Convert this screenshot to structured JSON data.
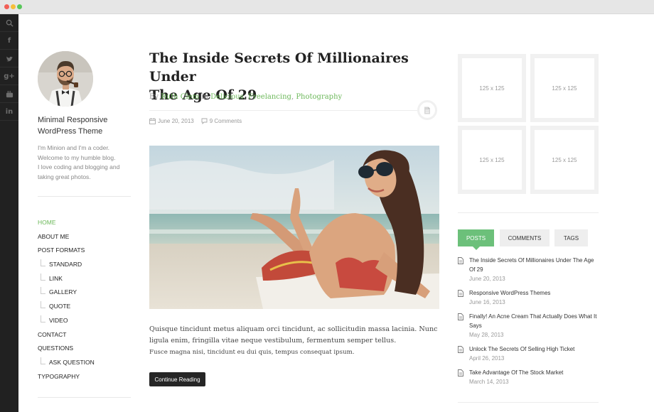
{
  "social": {
    "items": [
      {
        "name": "search-icon",
        "glyph": ""
      },
      {
        "name": "facebook-icon",
        "glyph": "f"
      },
      {
        "name": "twitter-icon",
        "glyph": ""
      },
      {
        "name": "google-plus-icon",
        "glyph": "g+"
      },
      {
        "name": "youtube-icon",
        "glyph": ""
      },
      {
        "name": "linkedin-icon",
        "glyph": "in"
      }
    ]
  },
  "sidebar": {
    "site_title_line1": "Minimal Responsive",
    "site_title_line2": "WordPress Theme",
    "description": [
      "I'm Minion and I'm a coder.",
      "Welcome to my humble blog.",
      "I love coding and blogging and",
      "taking great photos."
    ],
    "menu": [
      {
        "label": "Home",
        "active": true,
        "sub": false
      },
      {
        "label": "About Me",
        "active": false,
        "sub": false
      },
      {
        "label": "Post Formats",
        "active": false,
        "sub": false
      },
      {
        "label": "Standard",
        "active": false,
        "sub": true
      },
      {
        "label": "Link",
        "active": false,
        "sub": true
      },
      {
        "label": "Gallery",
        "active": false,
        "sub": true
      },
      {
        "label": "Quote",
        "active": false,
        "sub": true
      },
      {
        "label": "Video",
        "active": false,
        "sub": true
      },
      {
        "label": "Contact",
        "active": false,
        "sub": false
      },
      {
        "label": "Questions",
        "active": false,
        "sub": false
      },
      {
        "label": "Ask Question",
        "active": false,
        "sub": true
      },
      {
        "label": "Typography",
        "active": false,
        "sub": false
      }
    ]
  },
  "post": {
    "title_line1": "The Inside Secrets Of Millionaires Under",
    "title_line2": "The Age Of 29",
    "by": "By",
    "author": "Ruth Clem",
    "in": "in",
    "cat1": "Delicious",
    "cat2": "Freelancing",
    "cat3": "Photography",
    "sep": ", ",
    "date": "June 20, 2013",
    "comments": "9 Comments",
    "excerpt_line1": "Quisque tincidunt metus aliquam orci tincidunt, ac sollicitudin massa lacinia. Nunc",
    "excerpt_line2": "ligula enim, fringilla vitae neque vestibulum, fermentum semper tellus.",
    "excerpt_line3": "Fusce magna nisi, tincidunt eu dui quis, tempus consequat ipsum.",
    "continue_label": "Continue Reading"
  },
  "ads": [
    "125 x 125",
    "125 x 125",
    "125 x 125",
    "125 x 125"
  ],
  "tabs": [
    {
      "label": "Posts",
      "active": true
    },
    {
      "label": "Comments",
      "active": false
    },
    {
      "label": "Tags",
      "active": false
    }
  ],
  "recent_posts": [
    {
      "title_lines": [
        "The Inside Secrets Of Millionaires Under The Age",
        "Of 29"
      ],
      "date": "June 20, 2013"
    },
    {
      "title_lines": [
        "Responsive WordPress Themes"
      ],
      "date": "June 16, 2013"
    },
    {
      "title_lines": [
        "Finally! An Acne Cream That Actually Does What It",
        "Says"
      ],
      "date": "May 28, 2013"
    },
    {
      "title_lines": [
        "Unlock The Secrets Of Selling High Ticket"
      ],
      "date": "April 26, 2013"
    },
    {
      "title_lines": [
        "Take Advantage Of The Stock Market"
      ],
      "date": "March 14, 2013"
    }
  ],
  "colors": {
    "accent": "#6cb85a",
    "tab_active": "#6cc07a",
    "rail": "#212121",
    "button": "#262626"
  }
}
